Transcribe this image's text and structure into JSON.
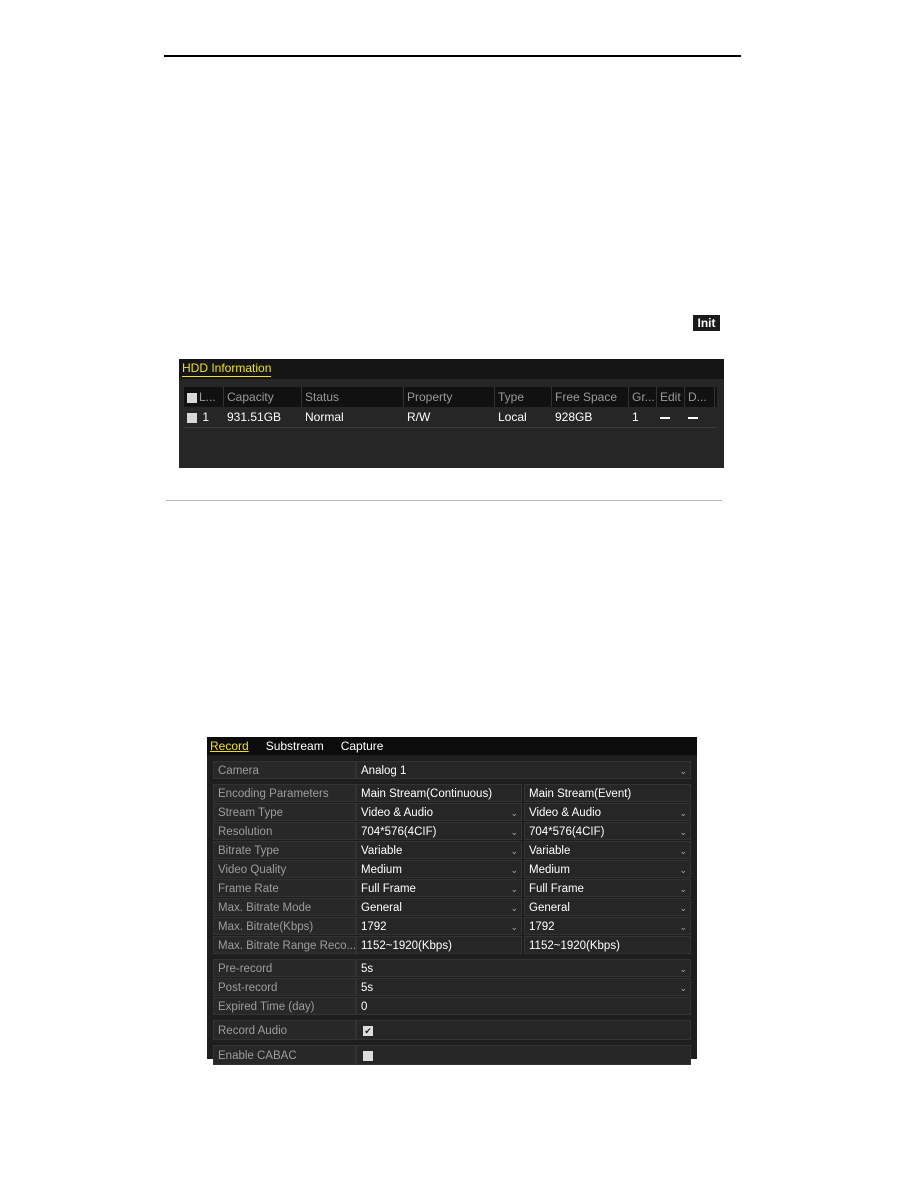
{
  "init_button": "Init",
  "hdd": {
    "title": "HDD Information",
    "columns": [
      "L...",
      "Capacity",
      "Status",
      "Property",
      "Type",
      "Free Space",
      "Gr...",
      "Edit",
      "D..."
    ],
    "rows": [
      {
        "label": "1",
        "capacity": "931.51GB",
        "status": "Normal",
        "property": "R/W",
        "type": "Local",
        "free_space": "928GB",
        "group": "1"
      }
    ]
  },
  "record": {
    "tabs": [
      "Record",
      "Substream",
      "Capture"
    ],
    "camera": {
      "label": "Camera",
      "value": "Analog 1"
    },
    "encoding": {
      "label": "Encoding Parameters",
      "col1": "Main Stream(Continuous)",
      "col2": "Main Stream(Event)"
    },
    "params": [
      {
        "label": "Stream Type",
        "v1": "Video & Audio",
        "v2": "Video & Audio"
      },
      {
        "label": "Resolution",
        "v1": "704*576(4CIF)",
        "v2": "704*576(4CIF)"
      },
      {
        "label": "Bitrate Type",
        "v1": "Variable",
        "v2": "Variable"
      },
      {
        "label": "Video Quality",
        "v1": "Medium",
        "v2": "Medium"
      },
      {
        "label": "Frame Rate",
        "v1": "Full Frame",
        "v2": "Full Frame"
      },
      {
        "label": "Max. Bitrate Mode",
        "v1": "General",
        "v2": "General"
      },
      {
        "label": "Max. Bitrate(Kbps)",
        "v1": "1792",
        "v2": "1792"
      }
    ],
    "range": {
      "label": "Max. Bitrate Range Reco...",
      "v1": "1152~1920(Kbps)",
      "v2": "1152~1920(Kbps)"
    },
    "pre_record": {
      "label": "Pre-record",
      "value": "5s"
    },
    "post_record": {
      "label": "Post-record",
      "value": "5s"
    },
    "expired": {
      "label": "Expired Time (day)",
      "value": "0"
    },
    "record_audio": {
      "label": "Record Audio",
      "checked": true
    },
    "cabac": {
      "label": "Enable CABAC",
      "checked": false
    }
  }
}
